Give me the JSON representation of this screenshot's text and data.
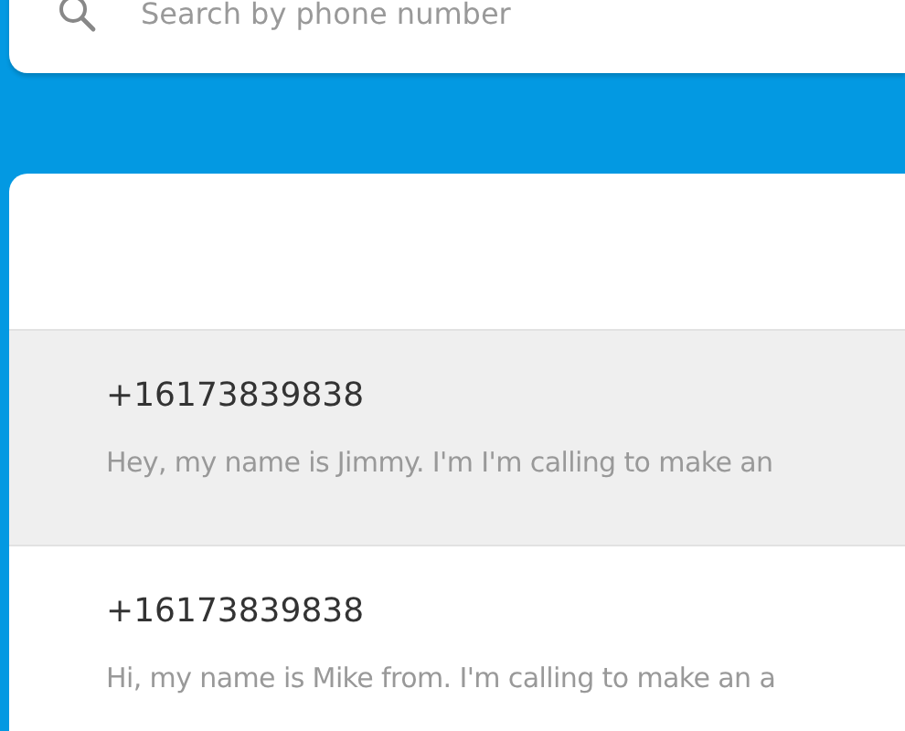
{
  "search": {
    "placeholder": "Search by phone number"
  },
  "conversations": [
    {
      "phone": "+16173839838",
      "preview": "Hey, my name is Jimmy. I'm I'm calling to make an",
      "selected": true
    },
    {
      "phone": "+16173839838",
      "preview": "Hi, my name is Mike from. I'm calling to make an a",
      "selected": false
    }
  ]
}
